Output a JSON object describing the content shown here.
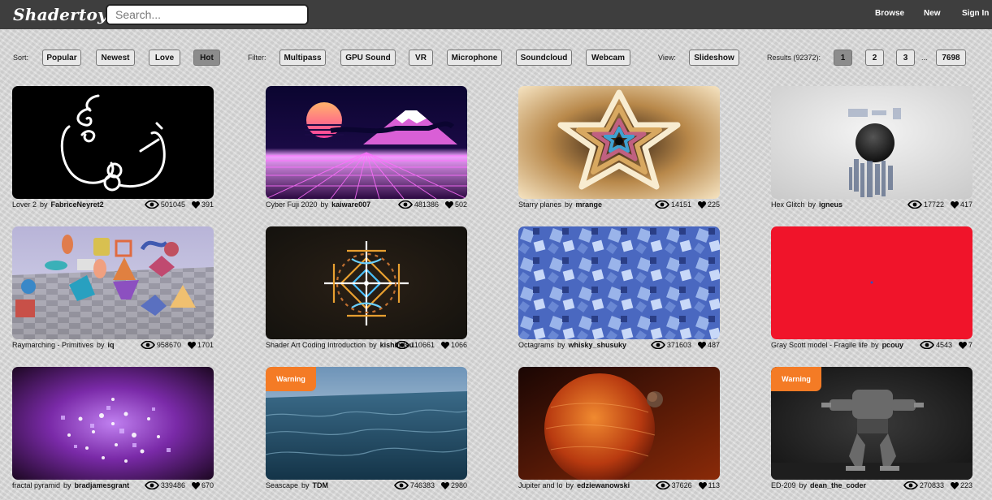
{
  "header": {
    "logo": "Shadertoy",
    "search_placeholder": "Search...",
    "nav": [
      "Browse",
      "New",
      "Sign In"
    ]
  },
  "toolbar": {
    "sort_label": "Sort:",
    "sort_options": [
      "Popular",
      "Newest",
      "Love",
      "Hot"
    ],
    "sort_active": "Hot",
    "filter_label": "Filter:",
    "filters": [
      "Multipass",
      "GPU Sound",
      "VR",
      "Microphone",
      "Soundcloud",
      "Webcam"
    ],
    "view_label": "View:",
    "view_button": "Slideshow",
    "results_label": "Results (92372):",
    "pages": [
      "1",
      "2",
      "3"
    ],
    "current_page": "1",
    "ellipsis": "...",
    "last_page": "7698"
  },
  "by_word": "by",
  "warning_label": "Warning",
  "shaders": [
    {
      "title": "Lover 2",
      "author": "FabriceNeyret2",
      "views": "501045",
      "likes": "391",
      "warning": false
    },
    {
      "title": "Cyber Fuji 2020",
      "author": "kaiware007",
      "views": "481386",
      "likes": "502",
      "warning": false
    },
    {
      "title": "Starry planes",
      "author": "mrange",
      "views": "14151",
      "likes": "225",
      "warning": false
    },
    {
      "title": "Hex Glitch",
      "author": "igneus",
      "views": "17722",
      "likes": "417",
      "warning": false
    },
    {
      "title": "Raymarching - Primitives",
      "author": "iq",
      "views": "958670",
      "likes": "1701",
      "warning": false
    },
    {
      "title": "Shader Art Coding Introduction",
      "author": "kishimisu",
      "views": "110661",
      "likes": "1066",
      "warning": false
    },
    {
      "title": "Octagrams",
      "author": "whisky_shusuky",
      "views": "371603",
      "likes": "487",
      "warning": false
    },
    {
      "title": "Gray Scott model - Fragile life",
      "author": "pcouy",
      "views": "4543",
      "likes": "7",
      "warning": false
    },
    {
      "title": "fractal pyramid",
      "author": "bradjamesgrant",
      "views": "339486",
      "likes": "670",
      "warning": false
    },
    {
      "title": "Seascape",
      "author": "TDM",
      "views": "746383",
      "likes": "2980",
      "warning": true
    },
    {
      "title": "Jupiter and Io",
      "author": "edziewanowski",
      "views": "37626",
      "likes": "113",
      "warning": false
    },
    {
      "title": "ED-209",
      "author": "dean_the_coder",
      "views": "270833",
      "likes": "223",
      "warning": true
    }
  ]
}
